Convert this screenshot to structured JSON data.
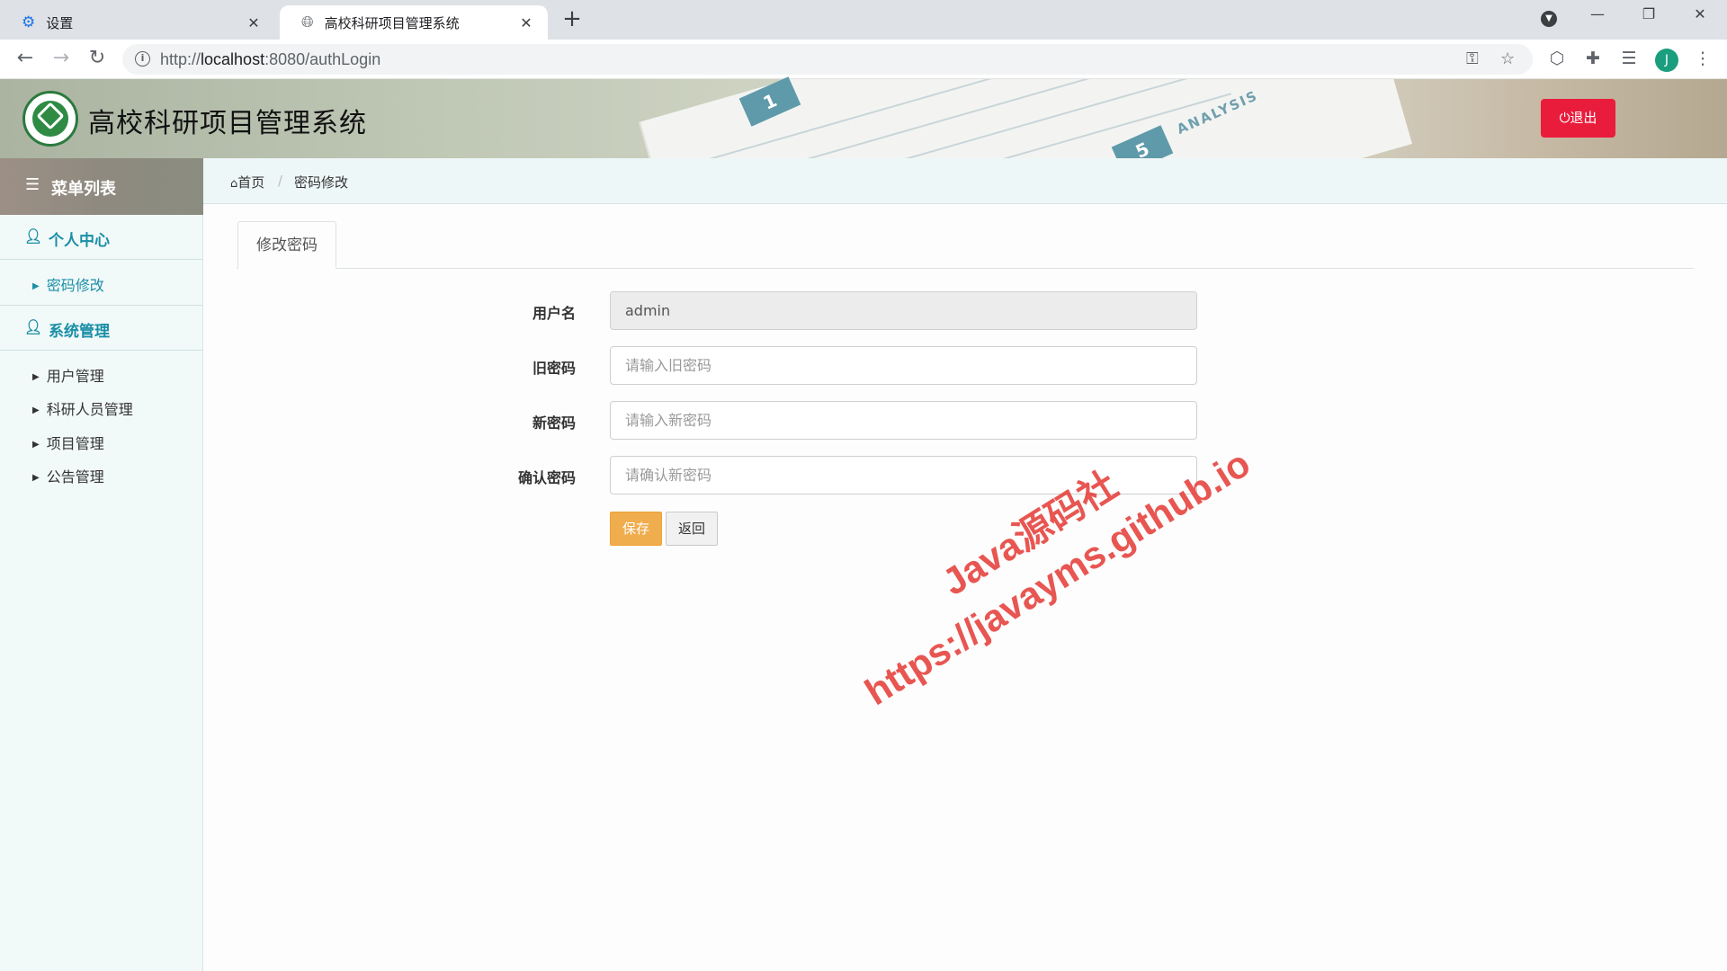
{
  "browser": {
    "tabs": [
      {
        "title": "设置",
        "icon": "gear-icon"
      },
      {
        "title": "高校科研项目管理系统",
        "icon": "globe-icon"
      }
    ],
    "url_prefix": "http://",
    "url_host": "localhost",
    "url_rest": ":8080/authLogin",
    "profile_initial": "J"
  },
  "header": {
    "title": "高校科研项目管理系统",
    "logout_label": "⏻退出",
    "banner_text_1": "1",
    "banner_text_5": "5",
    "banner_word": "ANALYSIS"
  },
  "sidebar": {
    "menu_title": "菜单列表",
    "groups": [
      {
        "title": "个人中心",
        "items": [
          "密码修改"
        ]
      },
      {
        "title": "系统管理",
        "items": [
          "用户管理",
          "科研人员管理",
          "项目管理",
          "公告管理"
        ]
      }
    ]
  },
  "breadcrumb": {
    "home": "首页",
    "separator": "/",
    "current": "密码修改"
  },
  "content": {
    "tab_label": "修改密码",
    "form": {
      "username_label": "用户名",
      "username_value": "admin",
      "old_password_label": "旧密码",
      "old_password_placeholder": "请输入旧密码",
      "new_password_label": "新密码",
      "new_password_placeholder": "请输入新密码",
      "confirm_password_label": "确认密码",
      "confirm_password_placeholder": "请确认新密码",
      "save_label": "保存",
      "back_label": "返回"
    }
  },
  "watermark": {
    "line1": "Java源码社",
    "line2": "https://javayms.github.io"
  },
  "colors": {
    "accent": "#1a8fa6",
    "logout": "#ea1c3c",
    "save": "#f0ad4e",
    "watermark": "#e53935"
  }
}
